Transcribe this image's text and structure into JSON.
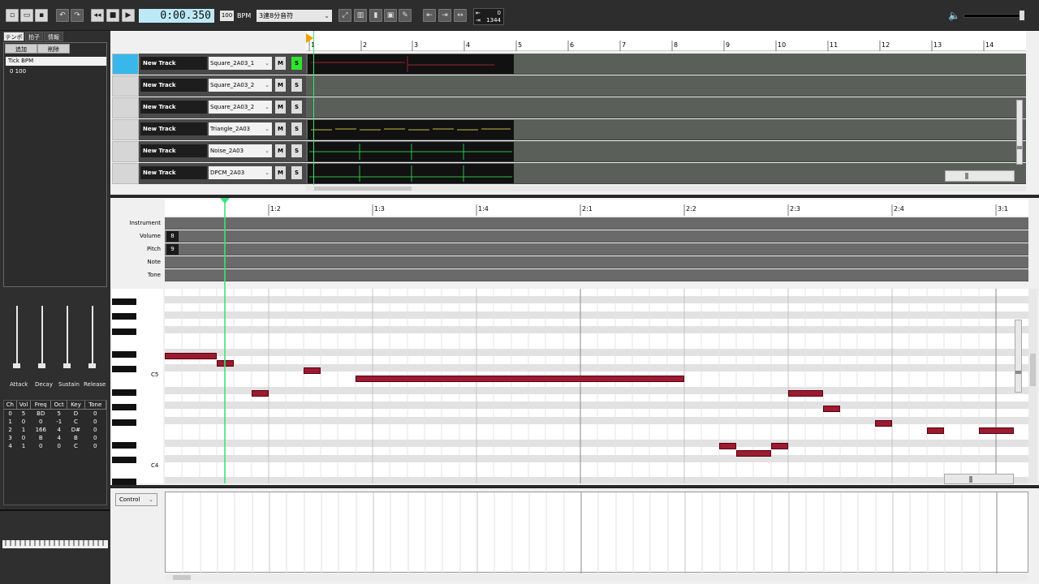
{
  "toolbar": {
    "time": "0:00.350",
    "bpm_value": "100",
    "bpm_label": "BPM",
    "quantize": "3連8分音符",
    "range_start": "0",
    "range_end": "1344"
  },
  "left_panel": {
    "tabs": [
      "テンポ",
      "拍子",
      "情報"
    ],
    "add_label": "追加",
    "delete_label": "削除",
    "tempo_header": "Tick  BPM",
    "tempo_rows": [
      "0      100"
    ],
    "adsr_labels": [
      "Attack",
      "Decay",
      "Sustain",
      "Release"
    ],
    "channel_table": {
      "headers": [
        "Ch",
        "Vol",
        "Freq",
        "Oct",
        "Key",
        "Tone"
      ],
      "rows": [
        [
          "0",
          "5",
          "BD",
          "5",
          "D",
          "0"
        ],
        [
          "1",
          "0",
          "0",
          "-1",
          "C",
          "0"
        ],
        [
          "2",
          "1",
          "166",
          "4",
          "D#",
          "0"
        ],
        [
          "3",
          "0",
          "B",
          "4",
          "B",
          "0"
        ],
        [
          "4",
          "1",
          "0",
          "0",
          "C",
          "0"
        ]
      ]
    }
  },
  "track_ruler": [
    "1",
    "2",
    "3",
    "4",
    "5",
    "6",
    "7",
    "8",
    "9",
    "10",
    "11",
    "12",
    "13",
    "14"
  ],
  "tracks": [
    {
      "name": "New Track",
      "instrument": "Square_2A03_1",
      "m": "M",
      "s": "S",
      "solo": true
    },
    {
      "name": "New Track",
      "instrument": "Square_2A03_2",
      "m": "M",
      "s": "S",
      "solo": false
    },
    {
      "name": "New Track",
      "instrument": "Square_2A03_2",
      "m": "M",
      "s": "S",
      "solo": false
    },
    {
      "name": "New Track",
      "instrument": "Triangle_2A03",
      "m": "M",
      "s": "S",
      "solo": false
    },
    {
      "name": "New Track",
      "instrument": "Noise_2A03",
      "m": "M",
      "s": "S",
      "solo": false
    },
    {
      "name": "New Track",
      "instrument": "DPCM_2A03",
      "m": "M",
      "s": "S",
      "solo": false
    }
  ],
  "piano_ruler": [
    "1:2",
    "1:3",
    "1:4",
    "2:1",
    "2:2",
    "2:3",
    "2:4",
    "3:1"
  ],
  "params": {
    "labels": [
      "Instrument",
      "Volume",
      "Pitch",
      "Note",
      "Tone"
    ],
    "volume_value": "8",
    "pitch_value": "9"
  },
  "key_labels": [
    "C5",
    "C4"
  ],
  "control": {
    "selector": "Control"
  }
}
